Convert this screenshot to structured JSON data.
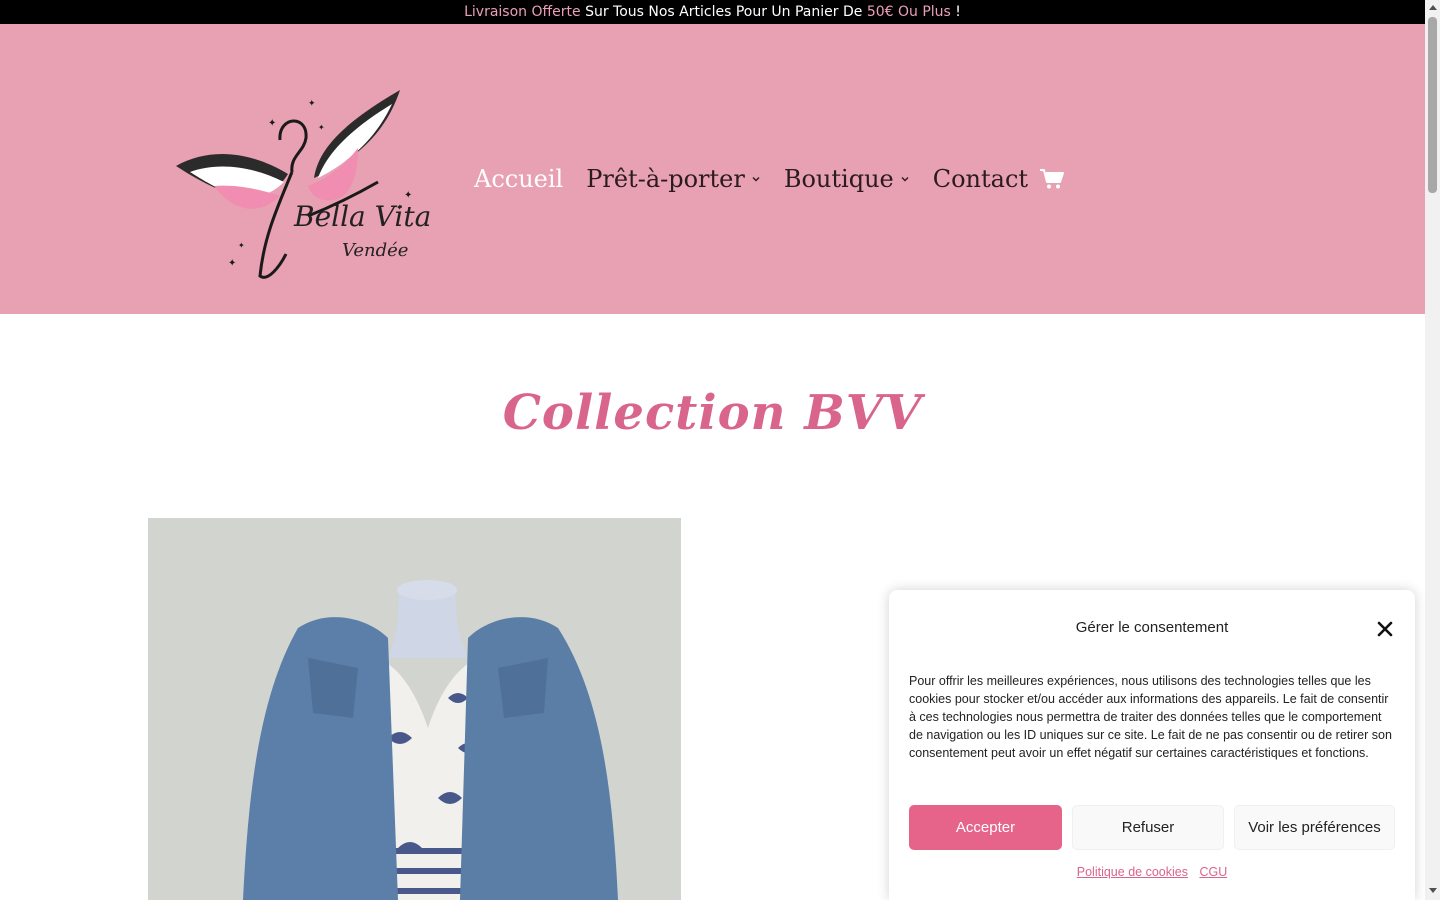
{
  "promo": {
    "part1": "Livraison Offerte",
    "part2": " Sur Tous Nos Articles Pour Un Panier De ",
    "part3": "50€ Ou Plus",
    "part4": " !"
  },
  "brand": {
    "name": "Bella Vita",
    "sub": "Vendée"
  },
  "nav": {
    "items": [
      {
        "label": "Accueil",
        "active": true,
        "dropdown": false
      },
      {
        "label": "Prêt-à-porter",
        "active": false,
        "dropdown": true
      },
      {
        "label": "Boutique",
        "active": false,
        "dropdown": true
      },
      {
        "label": "Contact",
        "active": false,
        "dropdown": false
      }
    ],
    "cart_icon": "shopping-cart-icon"
  },
  "main": {
    "collection_title": "Collection BVV"
  },
  "consent": {
    "title": "Gérer le consentement",
    "body": "Pour offrir les meilleures expériences, nous utilisons des technologies telles que les cookies pour stocker et/ou accéder aux informations des appareils. Le fait de consentir à ces technologies nous permettra de traiter des données telles que le comportement de navigation ou les ID uniques sur ce site. Le fait de ne pas consentir ou de retirer son consentement peut avoir un effet négatif sur certaines caractéristiques et fonctions.",
    "accept": "Accepter",
    "refuse": "Refuser",
    "preferences": "Voir les préférences",
    "link_cookies": "Politique de cookies",
    "link_cgu": "CGU"
  },
  "colors": {
    "header_bg": "#e8a0b3",
    "accent_pink": "#e6648a",
    "title_pink": "#d9648c",
    "promo_accent": "#e9a0b6"
  }
}
